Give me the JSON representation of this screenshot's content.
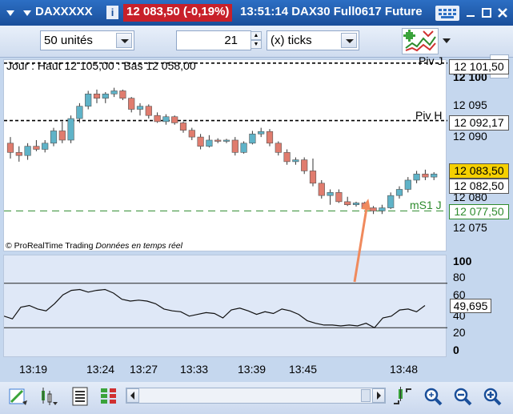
{
  "titlebar": {
    "symbol": "DAXXXXX",
    "info_label": "i",
    "price_change": "12 083,50 (-0,19%)",
    "title": "13:51:14 DAX30 Full0617 Future"
  },
  "toolbar": {
    "units_value": "50 unités",
    "ticks_value": "21",
    "ticks_mode": "(x) ticks"
  },
  "chart": {
    "ohlc_text": "Jour : Haut 12 105,00 : Bas 12 058,00",
    "copyright": "© ProRealTime Trading",
    "realtime": "Données en temps réel",
    "levels": {
      "piv_j": "Piv J",
      "piv_h": "Piv H",
      "ms1_j": "mS1 J"
    },
    "price_tags": {
      "piv_j": "12 101,50",
      "piv_h": "12 092,17",
      "last": "12 083,50",
      "current": "12 082,50",
      "ms1_j": "12 077,50"
    },
    "axis_labels": [
      "12 100",
      "12 095",
      "12 090",
      "12 080",
      "12 075"
    ],
    "colors": {
      "up": "#5fb3c8",
      "down": "#e07c6e",
      "last_tag": "#f5d000",
      "ms1": "#2e8b2e",
      "arrow": "#f08a5d"
    }
  },
  "chart_data": {
    "type": "candlestick",
    "title": "",
    "xlabel": "",
    "ylabel": "",
    "ylim": [
      12073,
      12102
    ],
    "x": [
      "13:19",
      "13:24",
      "13:27",
      "13:33",
      "13:39",
      "13:45",
      "13:48"
    ],
    "candles": [
      [
        12088.5,
        12089.5,
        12086.0,
        12087.0
      ],
      [
        12087.0,
        12088.0,
        12085.5,
        12086.5
      ],
      [
        12086.5,
        12088.5,
        12085.8,
        12088.0
      ],
      [
        12088.0,
        12089.0,
        12087.2,
        12087.5
      ],
      [
        12087.5,
        12089.0,
        12087.0,
        12088.5
      ],
      [
        12088.5,
        12091.0,
        12088.0,
        12090.5
      ],
      [
        12090.5,
        12092.0,
        12088.5,
        12089.0
      ],
      [
        12089.0,
        12093.0,
        12088.5,
        12092.5
      ],
      [
        12092.5,
        12095.0,
        12091.8,
        12094.5
      ],
      [
        12094.5,
        12097.0,
        12094.0,
        12096.5
      ],
      [
        12096.5,
        12097.2,
        12095.0,
        12095.8
      ],
      [
        12095.8,
        12096.8,
        12095.0,
        12096.5
      ],
      [
        12096.5,
        12097.5,
        12096.0,
        12097.0
      ],
      [
        12097.0,
        12097.2,
        12095.5,
        12095.8
      ],
      [
        12095.8,
        12096.0,
        12093.5,
        12094.0
      ],
      [
        12094.0,
        12095.0,
        12093.0,
        12094.5
      ],
      [
        12094.5,
        12094.8,
        12092.5,
        12093.0
      ],
      [
        12093.0,
        12093.5,
        12091.8,
        12092.0
      ],
      [
        12092.0,
        12093.2,
        12091.5,
        12092.8
      ],
      [
        12092.8,
        12093.0,
        12091.5,
        12091.8
      ],
      [
        12091.8,
        12092.0,
        12090.2,
        12090.6
      ],
      [
        12090.6,
        12091.0,
        12089.0,
        12089.5
      ],
      [
        12089.5,
        12090.0,
        12087.5,
        12088.0
      ],
      [
        12088.0,
        12089.8,
        12087.8,
        12089.0
      ],
      [
        12089.0,
        12089.3,
        12088.5,
        12088.8
      ],
      [
        12088.8,
        12089.2,
        12088.5,
        12089.0
      ],
      [
        12089.0,
        12089.5,
        12086.5,
        12087.0
      ],
      [
        12087.0,
        12088.8,
        12086.8,
        12088.5
      ],
      [
        12088.5,
        12090.5,
        12088.3,
        12090.0
      ],
      [
        12090.0,
        12091.0,
        12089.5,
        12090.4
      ],
      [
        12090.4,
        12090.8,
        12088.0,
        12088.5
      ],
      [
        12088.5,
        12088.8,
        12086.5,
        12087.0
      ],
      [
        12087.0,
        12087.5,
        12085.0,
        12085.5
      ],
      [
        12085.5,
        12086.2,
        12085.0,
        12085.8
      ],
      [
        12085.8,
        12086.2,
        12083.5,
        12084.0
      ],
      [
        12084.0,
        12086.0,
        12081.5,
        12082.0
      ],
      [
        12082.0,
        12082.5,
        12079.5,
        12080.0
      ],
      [
        12080.0,
        12081.0,
        12078.5,
        12080.5
      ],
      [
        12080.5,
        12081.0,
        12078.8,
        12079.0
      ],
      [
        12079.0,
        12079.8,
        12078.3,
        12078.5
      ],
      [
        12078.5,
        12079.0,
        12078.2,
        12078.8
      ],
      [
        12078.8,
        12079.0,
        12077.8,
        12078.0
      ],
      [
        12078.0,
        12078.3,
        12077.0,
        12077.5
      ],
      [
        12077.5,
        12078.5,
        12077.0,
        12078.0
      ],
      [
        12078.0,
        12080.5,
        12077.8,
        12080.0
      ],
      [
        12080.0,
        12081.5,
        12079.5,
        12081.0
      ],
      [
        12081.0,
        12083.0,
        12080.5,
        12082.5
      ],
      [
        12082.5,
        12084.0,
        12082.0,
        12083.5
      ],
      [
        12083.5,
        12084.2,
        12082.5,
        12083.0
      ],
      [
        12083.0,
        12083.8,
        12082.5,
        12083.5
      ]
    ],
    "levels": [
      {
        "name": "Piv J",
        "value": 12101.5,
        "style": "dashed-black"
      },
      {
        "name": "Piv H",
        "value": 12092.17,
        "style": "dashed-black"
      },
      {
        "name": "mS1 J",
        "value": 12077.5,
        "style": "dashed-green"
      }
    ],
    "oscillator": {
      "ylim": [
        0,
        100
      ],
      "ticks": [
        0,
        20,
        40,
        60,
        80,
        100
      ],
      "bands": [
        25,
        75
      ],
      "last_value": "49,695",
      "values": [
        38,
        35,
        48,
        50,
        46,
        44,
        52,
        62,
        67,
        68,
        65,
        67,
        68,
        64,
        57,
        55,
        56,
        55,
        52,
        46,
        44,
        43,
        38,
        40,
        42,
        41,
        36,
        45,
        47,
        44,
        40,
        43,
        41,
        46,
        44,
        40,
        33,
        30,
        28,
        28,
        27,
        28,
        27,
        30,
        25,
        36,
        38,
        45,
        46,
        43,
        50
      ]
    }
  },
  "osc": {
    "axis_labels": [
      "100",
      "80",
      "60",
      "40",
      "20",
      "0"
    ],
    "value_tag": "49,695"
  },
  "time_axis": [
    "13:19",
    "13:24",
    "13:27",
    "13:33",
    "13:39",
    "13:45",
    "13:48"
  ]
}
